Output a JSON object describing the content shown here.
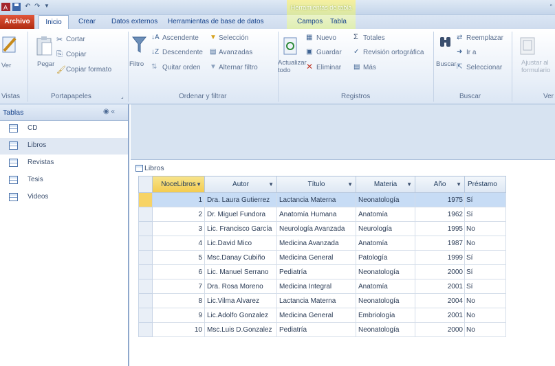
{
  "app": {
    "context_tab_title": "Herramientas de tabla"
  },
  "ribbon_tabs": [
    "Archivo",
    "Inicio",
    "Crear",
    "Datos externos",
    "Herramientas de base de datos",
    "Campos",
    "Tabla"
  ],
  "ribbon": {
    "vistas": {
      "button": "Ver",
      "group": "Vistas"
    },
    "portapapeles": {
      "pegar": "Pegar",
      "cortar": "Cortar",
      "copiar": "Copiar",
      "copiar_formato": "Copiar formato",
      "group": "Portapapeles"
    },
    "ordenar": {
      "filtro": "Filtro",
      "ascendente": "Ascendente",
      "descendente": "Descendente",
      "quitar_orden": "Quitar orden",
      "seleccion": "Selección",
      "avanzadas": "Avanzadas",
      "alternar_filtro": "Alternar filtro",
      "group": "Ordenar y filtrar"
    },
    "registros": {
      "actualizar": "Actualizar todo",
      "nuevo": "Nuevo",
      "guardar": "Guardar",
      "eliminar": "Eliminar",
      "totales": "Totales",
      "ortografia": "Revisión ortográfica",
      "mas": "Más",
      "group": "Registros"
    },
    "buscar": {
      "buscar": "Buscar",
      "reemplazar": "Reemplazar",
      "ir_a": "Ir a",
      "seleccionar": "Seleccionar",
      "group": "Buscar"
    },
    "texto": {
      "ajustar": "Ajustar al formulario",
      "group": "Ver"
    }
  },
  "nav": {
    "title": "Tablas",
    "items": [
      "CD",
      "Libros",
      "Revistas",
      "Tesis",
      "Videos"
    ]
  },
  "document": {
    "tab_label": "Libros",
    "columns": [
      "NoceLibros",
      "Autor",
      "Título",
      "Materia",
      "Año",
      "Préstamo"
    ],
    "rows": [
      [
        "1",
        "Dra. Laura Gutierrez",
        "Lactancia Materna",
        "Neonatología",
        "1975",
        "Sí"
      ],
      [
        "2",
        "Dr. Miguel Fundora",
        "Anatomía Humana",
        "Anatomía",
        "1962",
        "Sí"
      ],
      [
        "3",
        "Lic. Francisco García",
        "Neurología Avanzada",
        "Neurología",
        "1995",
        "No"
      ],
      [
        "4",
        "Lic.David Mico",
        "Medicina Avanzada",
        "Anatomía",
        "1987",
        "No"
      ],
      [
        "5",
        "Msc.Danay Cubiño",
        "Medicina General",
        "Patología",
        "1999",
        "Sí"
      ],
      [
        "6",
        "Lic. Manuel Serrano",
        "Pediatría",
        "Neonatología",
        "2000",
        "Sí"
      ],
      [
        "7",
        "Dra. Rosa Moreno",
        "Medicina Integral",
        "Anatomía",
        "2001",
        "Sí"
      ],
      [
        "8",
        "Lic.Vilma Alvarez",
        "Lactancia Materna",
        "Neonatología",
        "2004",
        "No"
      ],
      [
        "9",
        "Lic.Adolfo Gonzalez",
        "Medicina General",
        "Embriología",
        "2001",
        "No"
      ],
      [
        "10",
        "Msc.Luis D.Gonzalez",
        "Pediatría",
        "Neonatología",
        "2000",
        "No"
      ]
    ]
  }
}
